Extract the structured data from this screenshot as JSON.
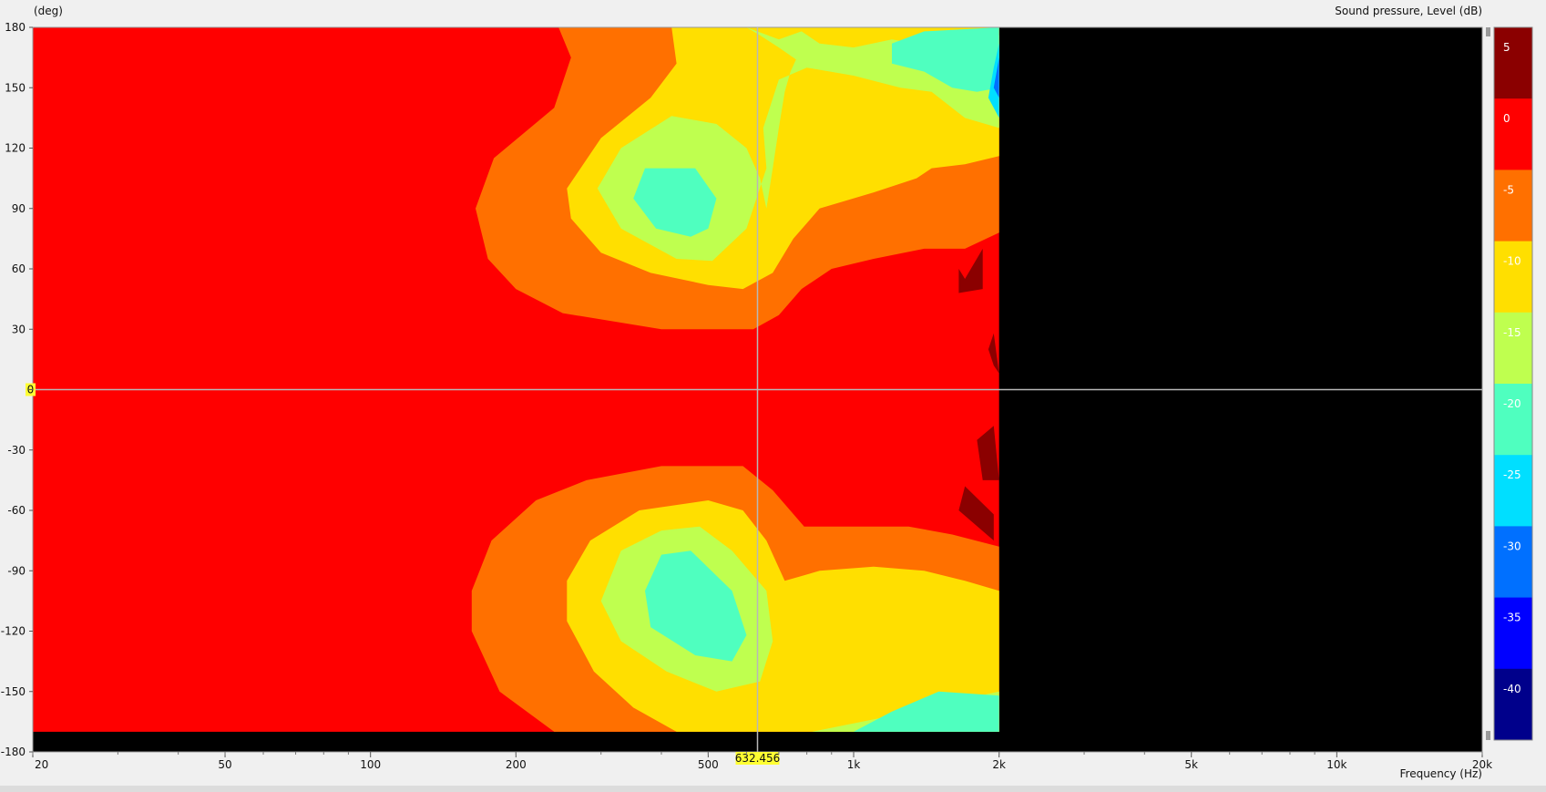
{
  "chart_data": {
    "type": "heatmap",
    "title": "Sound pressure, Level  (dB)",
    "ylabel": "(deg)",
    "xlabel": "Frequency  (Hz)",
    "x_scale": "log",
    "xlim": [
      20,
      20000
    ],
    "ylim": [
      -180,
      180
    ],
    "x_ticks": [
      20,
      50,
      100,
      200,
      500,
      1000,
      2000,
      5000,
      10000,
      20000
    ],
    "x_tick_labels": [
      "20",
      "50",
      "100",
      "200",
      "500",
      "1k",
      "2k",
      "5k",
      "10k",
      "20k"
    ],
    "y_ticks": [
      180,
      150,
      120,
      90,
      60,
      30,
      0,
      -30,
      -60,
      -90,
      -120,
      -150,
      -180
    ],
    "y_tick_labels": [
      "180",
      "150",
      "120",
      "90",
      "60",
      "30",
      "0",
      "-30",
      "-60",
      "-90",
      "-120",
      "-150",
      "-180"
    ],
    "data_extent": {
      "f_max_hz": 2000,
      "angle_min_deg": -170
    },
    "cursor": {
      "frequency_hz": 632.456,
      "frequency_label": "632.456",
      "angle_deg": 0,
      "angle_label": "0"
    },
    "colorbar": {
      "ticks": [
        5,
        0,
        -5,
        -10,
        -15,
        -20,
        -25,
        -30,
        -35,
        -40
      ],
      "tick_labels": [
        "5",
        "0",
        "-5",
        "-10",
        "-15",
        "-20",
        "-25",
        "-30",
        "-35",
        "-40"
      ],
      "bands": [
        {
          "min": 0,
          "max": 10,
          "color": "#8b0000"
        },
        {
          "min": -5,
          "max": 0,
          "color": "#ff0000"
        },
        {
          "min": -10,
          "max": -5,
          "color": "#ff7000"
        },
        {
          "min": -15,
          "max": -10,
          "color": "#ffdf00"
        },
        {
          "min": -20,
          "max": -15,
          "color": "#bfff4f"
        },
        {
          "min": -25,
          "max": -20,
          "color": "#4fffbf"
        },
        {
          "min": -30,
          "max": -25,
          "color": "#00dfff"
        },
        {
          "min": -35,
          "max": -30,
          "color": "#0070ff"
        },
        {
          "min": -40,
          "max": -35,
          "color": "#0000ff"
        },
        {
          "min": -45,
          "max": -40,
          "color": "#00008b"
        }
      ]
    },
    "contours": [
      {
        "level": -5,
        "color": "#ff7000",
        "points": [
          [
            245,
            180
          ],
          [
            260,
            165
          ],
          [
            240,
            140
          ],
          [
            180,
            115
          ],
          [
            165,
            90
          ],
          [
            175,
            65
          ],
          [
            200,
            50
          ],
          [
            250,
            38
          ],
          [
            400,
            30
          ],
          [
            620,
            30
          ],
          [
            700,
            37
          ],
          [
            780,
            50
          ],
          [
            900,
            60
          ],
          [
            1100,
            65
          ],
          [
            1400,
            70
          ],
          [
            1700,
            70
          ],
          [
            2000,
            78
          ],
          [
            2000,
            180
          ]
        ]
      },
      {
        "level": -10,
        "color": "#ffdf00",
        "points": [
          [
            420,
            180
          ],
          [
            430,
            162
          ],
          [
            380,
            145
          ],
          [
            300,
            125
          ],
          [
            255,
            100
          ],
          [
            260,
            85
          ],
          [
            300,
            68
          ],
          [
            380,
            58
          ],
          [
            500,
            52
          ],
          [
            590,
            50
          ],
          [
            680,
            58
          ],
          [
            750,
            75
          ],
          [
            850,
            90
          ],
          [
            1100,
            98
          ],
          [
            1350,
            105
          ],
          [
            1450,
            110
          ],
          [
            1700,
            112
          ],
          [
            2000,
            116
          ],
          [
            2000,
            180
          ]
        ]
      },
      {
        "level": -15,
        "color": "#bfff4f",
        "points": [
          [
            600,
            180
          ],
          [
            700,
            174
          ],
          [
            780,
            178
          ],
          [
            850,
            172
          ],
          [
            1000,
            170
          ],
          [
            1200,
            174
          ],
          [
            1350,
            172
          ],
          [
            1600,
            176
          ],
          [
            2000,
            176
          ],
          [
            2000,
            130
          ],
          [
            1700,
            135
          ],
          [
            1450,
            148
          ],
          [
            1250,
            150
          ],
          [
            1000,
            156
          ],
          [
            800,
            160
          ],
          [
            700,
            154
          ],
          [
            650,
            130
          ],
          [
            660,
            110
          ],
          [
            600,
            80
          ],
          [
            510,
            64
          ],
          [
            430,
            65
          ],
          [
            330,
            80
          ],
          [
            295,
            100
          ],
          [
            330,
            120
          ],
          [
            420,
            136
          ],
          [
            520,
            132
          ],
          [
            600,
            120
          ],
          [
            640,
            105
          ],
          [
            660,
            90
          ],
          [
            680,
            110
          ],
          [
            700,
            130
          ],
          [
            720,
            148
          ],
          [
            740,
            158
          ],
          [
            760,
            164
          ],
          [
            700,
            170
          ],
          [
            640,
            176
          ],
          [
            600,
            180
          ]
        ]
      },
      {
        "level": -20,
        "color": "#4fffbf",
        "points": [
          [
            370,
            110
          ],
          [
            470,
            110
          ],
          [
            520,
            95
          ],
          [
            500,
            80
          ],
          [
            460,
            76
          ],
          [
            390,
            80
          ],
          [
            350,
            95
          ]
        ]
      },
      {
        "level": -20,
        "color": "#4fffbf",
        "points": [
          [
            1200,
            162
          ],
          [
            1400,
            158
          ],
          [
            1600,
            150
          ],
          [
            1800,
            148
          ],
          [
            2000,
            150
          ],
          [
            2000,
            180
          ],
          [
            1400,
            178
          ],
          [
            1200,
            172
          ]
        ]
      },
      {
        "level": -5,
        "color": "#ff7000",
        "points": [
          [
            240,
            -170
          ],
          [
            185,
            -150
          ],
          [
            162,
            -120
          ],
          [
            162,
            -100
          ],
          [
            178,
            -75
          ],
          [
            220,
            -55
          ],
          [
            280,
            -45
          ],
          [
            400,
            -38
          ],
          [
            590,
            -38
          ],
          [
            680,
            -50
          ],
          [
            790,
            -68
          ],
          [
            1000,
            -68
          ],
          [
            1300,
            -68
          ],
          [
            1600,
            -72
          ],
          [
            2000,
            -78
          ],
          [
            2000,
            -170
          ]
        ]
      },
      {
        "level": -10,
        "color": "#ffdf00",
        "points": [
          [
            430,
            -170
          ],
          [
            350,
            -158
          ],
          [
            290,
            -140
          ],
          [
            255,
            -115
          ],
          [
            255,
            -95
          ],
          [
            285,
            -75
          ],
          [
            360,
            -60
          ],
          [
            500,
            -55
          ],
          [
            590,
            -60
          ],
          [
            660,
            -75
          ],
          [
            720,
            -95
          ],
          [
            850,
            -90
          ],
          [
            1100,
            -88
          ],
          [
            1400,
            -90
          ],
          [
            1700,
            -95
          ],
          [
            2000,
            -100
          ],
          [
            2000,
            -170
          ]
        ]
      },
      {
        "level": -15,
        "color": "#bfff4f",
        "points": [
          [
            820,
            -170
          ],
          [
            1200,
            -162
          ],
          [
            1600,
            -155
          ],
          [
            2000,
            -150
          ],
          [
            2000,
            -170
          ]
        ]
      },
      {
        "level": -15,
        "color": "#bfff4f",
        "points": [
          [
            300,
            -105
          ],
          [
            330,
            -80
          ],
          [
            400,
            -70
          ],
          [
            480,
            -68
          ],
          [
            560,
            -80
          ],
          [
            660,
            -100
          ],
          [
            680,
            -125
          ],
          [
            640,
            -145
          ],
          [
            520,
            -150
          ],
          [
            410,
            -140
          ],
          [
            330,
            -125
          ]
        ]
      },
      {
        "level": -20,
        "color": "#4fffbf",
        "points": [
          [
            370,
            -100
          ],
          [
            400,
            -82
          ],
          [
            460,
            -80
          ],
          [
            560,
            -100
          ],
          [
            600,
            -122
          ],
          [
            560,
            -135
          ],
          [
            470,
            -132
          ],
          [
            380,
            -118
          ]
        ]
      },
      {
        "level": -20,
        "color": "#4fffbf",
        "points": [
          [
            1000,
            -170
          ],
          [
            1200,
            -160
          ],
          [
            1500,
            -150
          ],
          [
            2000,
            -152
          ],
          [
            2000,
            -170
          ]
        ]
      },
      {
        "level": 0,
        "color": "#8b0000",
        "points": [
          [
            1650,
            60
          ],
          [
            1700,
            55
          ],
          [
            1850,
            70
          ],
          [
            1850,
            50
          ],
          [
            1650,
            48
          ]
        ]
      },
      {
        "level": 0,
        "color": "#8b0000",
        "points": [
          [
            1900,
            20
          ],
          [
            1950,
            12
          ],
          [
            2000,
            8
          ],
          [
            1950,
            28
          ]
        ]
      },
      {
        "level": 0,
        "color": "#8b0000",
        "points": [
          [
            1800,
            -25
          ],
          [
            1950,
            -18
          ],
          [
            2000,
            -45
          ],
          [
            1850,
            -45
          ]
        ]
      },
      {
        "level": 0,
        "color": "#8b0000",
        "points": [
          [
            1650,
            -60
          ],
          [
            1700,
            -48
          ],
          [
            1950,
            -62
          ],
          [
            1950,
            -75
          ]
        ]
      },
      {
        "level": -25,
        "color": "#00dfff",
        "points": [
          [
            1900,
            145
          ],
          [
            2000,
            135
          ],
          [
            2000,
            172
          ],
          [
            1950,
            160
          ]
        ]
      },
      {
        "level": -30,
        "color": "#0070ff",
        "points": [
          [
            1950,
            150
          ],
          [
            2000,
            145
          ],
          [
            2000,
            165
          ]
        ]
      }
    ]
  }
}
